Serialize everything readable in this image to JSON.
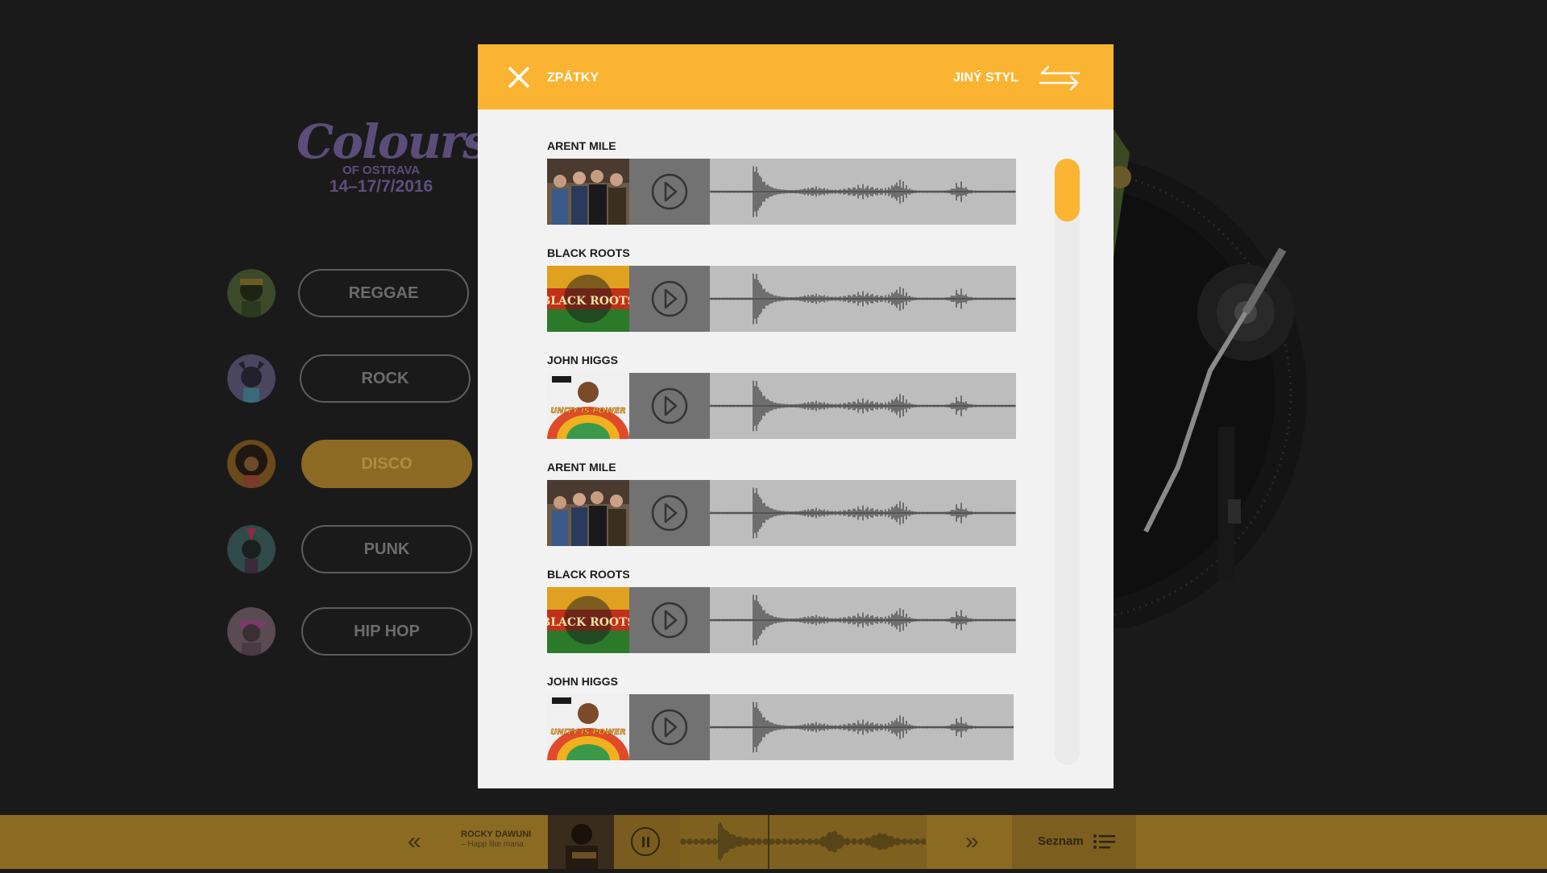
{
  "festival": {
    "logo_word": "Colours",
    "logo_sub": "OF OSTRAVA",
    "logo_date": "14–17/7/2016"
  },
  "genres": [
    {
      "label": "REGGAE",
      "active": false,
      "avatar_color": "#3c4a2a"
    },
    {
      "label": "ROCK",
      "active": false,
      "avatar_color": "#4a4660"
    },
    {
      "label": "DISCO",
      "active": true,
      "avatar_color": "#6a4a1a"
    },
    {
      "label": "PUNK",
      "active": false,
      "avatar_color": "#2f4a48"
    },
    {
      "label": "HIP HOP",
      "active": false,
      "avatar_color": "#5a4a52"
    }
  ],
  "modal": {
    "back_label": "ZPÁTKY",
    "style_label": "JINÝ STYL",
    "tracks": [
      {
        "artist": "ARENT MILE",
        "cover": "band"
      },
      {
        "artist": "BLACK ROOTS",
        "cover": "blackroots",
        "cover_text": "BLACK ROOTS"
      },
      {
        "artist": "JOHN HIGGS",
        "cover": "unity",
        "cover_text": "UNITY IS POWER"
      },
      {
        "artist": "ARENT MILE",
        "cover": "band"
      },
      {
        "artist": "BLACK ROOTS",
        "cover": "blackroots",
        "cover_text": "BLACK ROOTS"
      },
      {
        "artist": "JOHN HIGGS",
        "cover": "unity",
        "cover_text": "UNITY IS POWER"
      }
    ]
  },
  "player": {
    "artist": "ROCKY DAWUNI",
    "song": "– Happ like mana",
    "list_label": "Seznam"
  },
  "colors": {
    "accent": "#fbb431",
    "player_bar": "#8b6a22"
  }
}
